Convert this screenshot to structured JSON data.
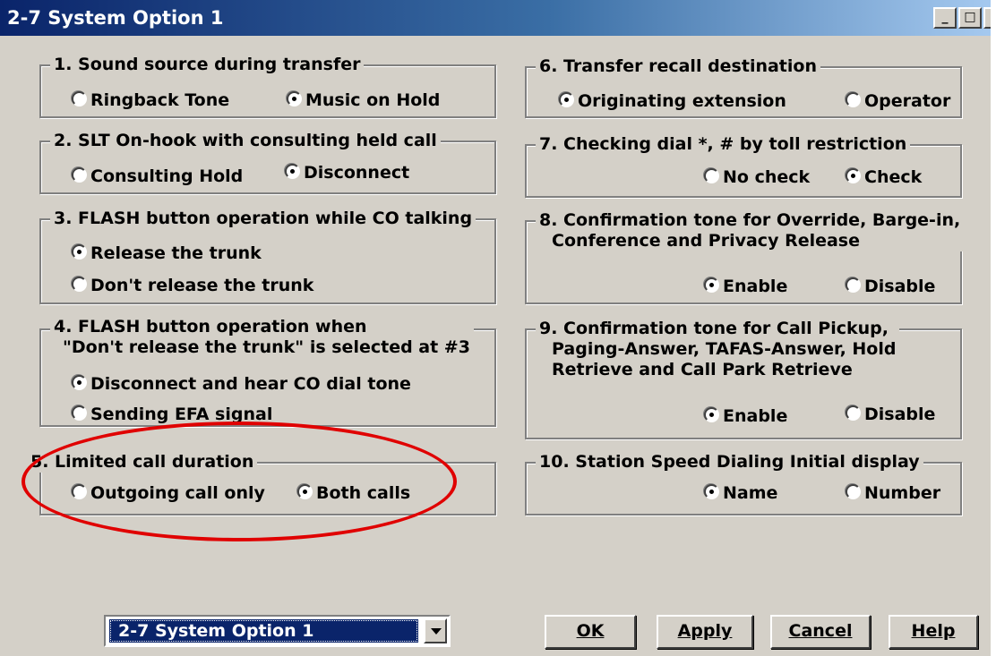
{
  "window": {
    "title": "2-7 System Option 1"
  },
  "groups": {
    "g1": {
      "legend": "1. Sound source during transfer",
      "options": [
        "Ringback Tone",
        "Music on Hold"
      ],
      "selected": 1
    },
    "g2": {
      "legend": "2. SLT On-hook with consulting held call",
      "options": [
        "Consulting Hold",
        "Disconnect"
      ],
      "selected": 1
    },
    "g3": {
      "legend": "3. FLASH button operation while CO talking",
      "options": [
        "Release the trunk",
        "Don't release the trunk"
      ],
      "selected": 0
    },
    "g4": {
      "legend_line1": "4. FLASH button operation when",
      "legend_line2": "\"Don't release the trunk\" is selected at #3",
      "options": [
        "Disconnect and hear CO dial tone",
        "Sending EFA signal"
      ],
      "selected": 0
    },
    "g5": {
      "legend": "5. Limited call duration",
      "options": [
        "Outgoing call only",
        "Both calls"
      ],
      "selected": 1
    },
    "g6": {
      "legend": "6. Transfer recall destination",
      "options": [
        "Originating extension",
        "Operator"
      ],
      "selected": 0
    },
    "g7": {
      "legend": "7. Checking dial *, # by toll restriction",
      "options": [
        "No check",
        "Check"
      ],
      "selected": 1
    },
    "g8": {
      "legend_line1": "8. Confirmation tone for Override, Barge-in,",
      "legend_line2": "Conference and Privacy Release",
      "options": [
        "Enable",
        "Disable"
      ],
      "selected": 0
    },
    "g9": {
      "legend_line1": "9. Confirmation tone for Call Pickup,",
      "legend_line2": "Paging-Answer, TAFAS-Answer, Hold",
      "legend_line3": "Retrieve and Call Park Retrieve",
      "options": [
        "Enable",
        "Disable"
      ],
      "selected": 0
    },
    "g10": {
      "legend": "10. Station Speed Dialing Initial display",
      "options": [
        "Name",
        "Number"
      ],
      "selected": 0
    }
  },
  "footer": {
    "page_select": "2-7 System Option 1",
    "ok": "OK",
    "apply": "Apply",
    "cancel": "Cancel",
    "help": "Help"
  },
  "annotation": {
    "color": "#e00000",
    "shape": "ellipse",
    "target": "5. Limited call duration"
  }
}
